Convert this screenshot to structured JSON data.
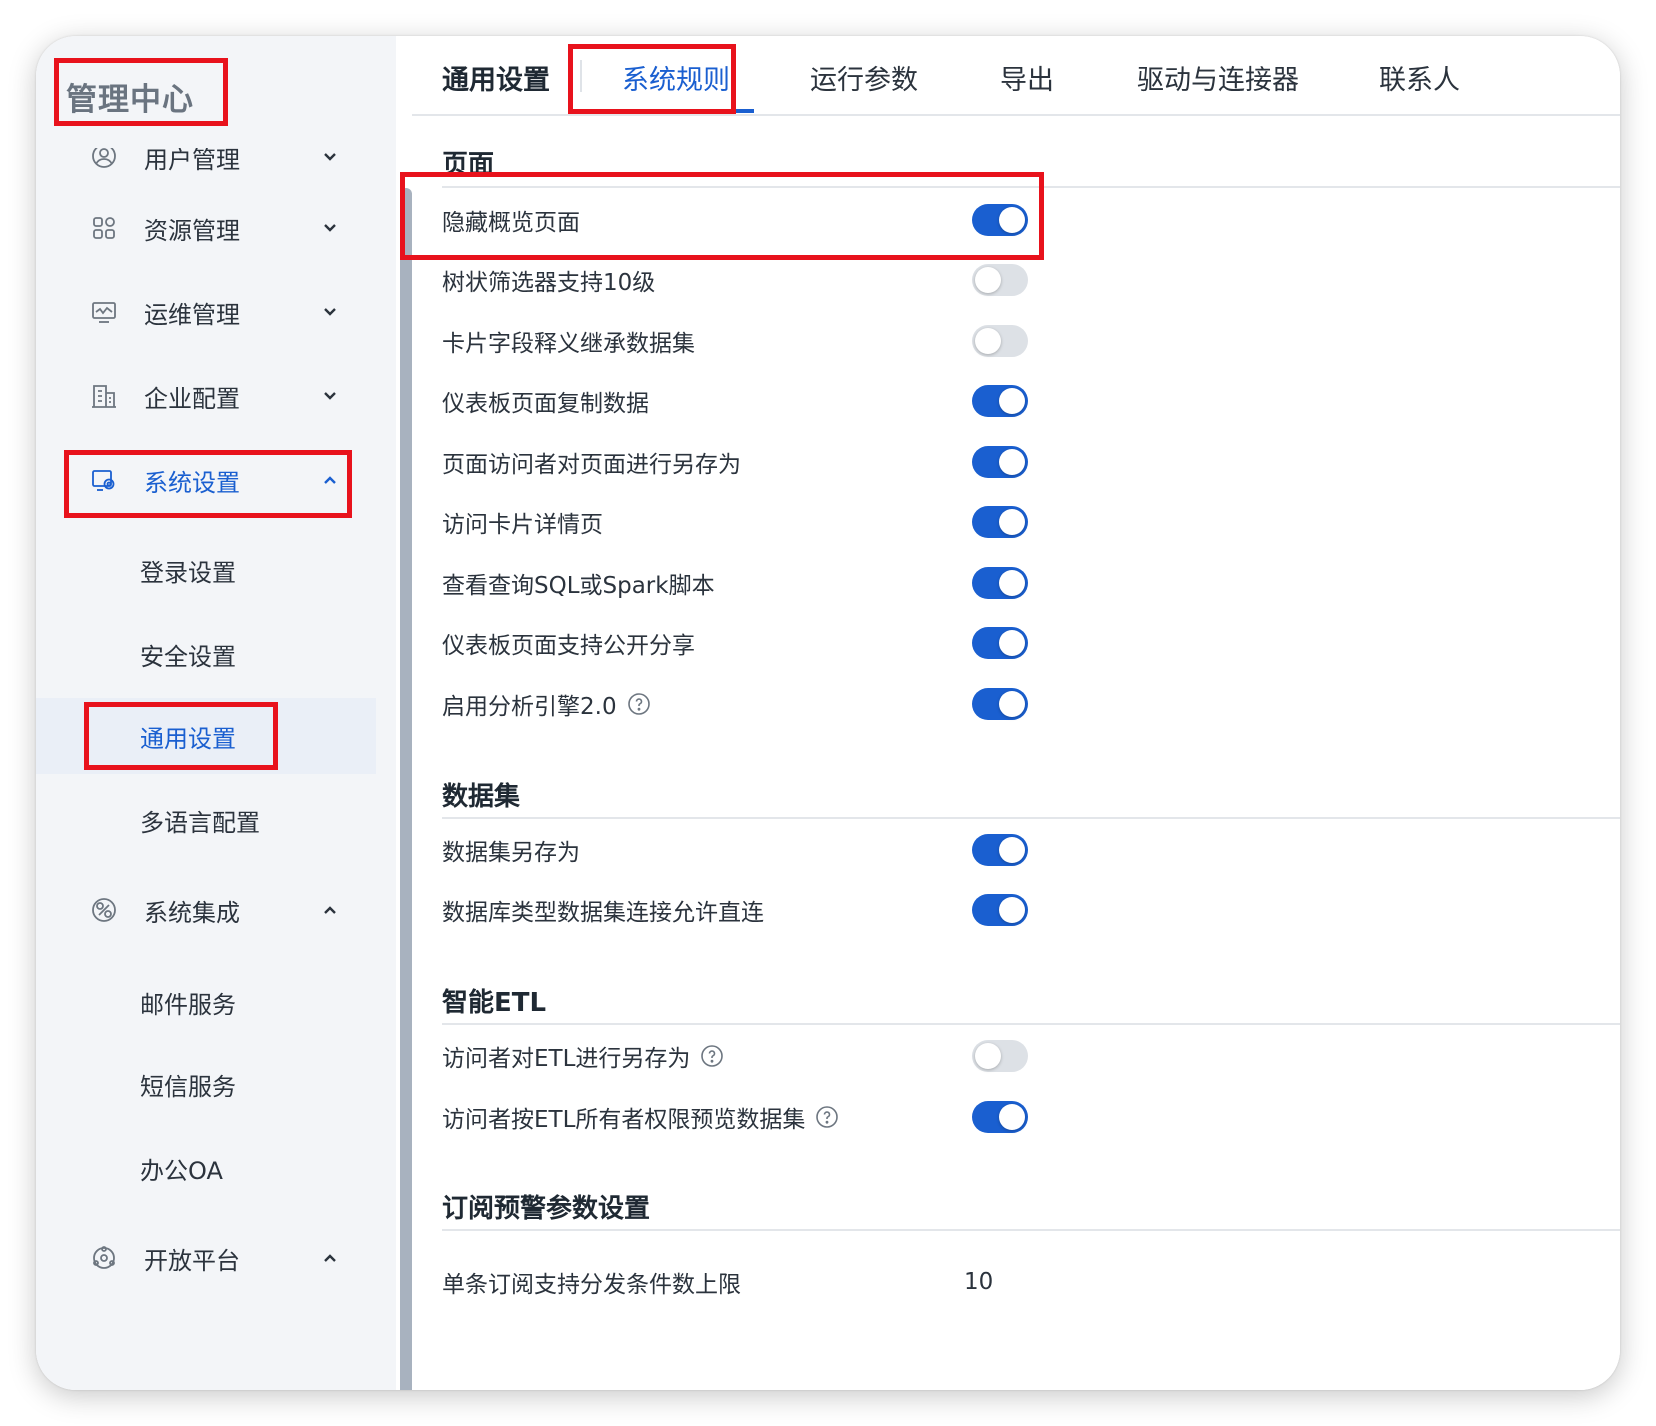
{
  "sidebar": {
    "title": "管理中心",
    "partial_item": {
      "label": "用户管理",
      "icon": "user-icon"
    },
    "items": [
      {
        "label": "资源管理",
        "icon": "grid-icon",
        "expanded": false
      },
      {
        "label": "运维管理",
        "icon": "monitor-icon",
        "expanded": false
      },
      {
        "label": "企业配置",
        "icon": "building-icon",
        "expanded": false
      },
      {
        "label": "系统设置",
        "icon": "settings-icon",
        "expanded": true,
        "active": true
      }
    ],
    "system_settings_children": [
      "登录设置",
      "安全设置",
      "通用设置",
      "多语言配置"
    ],
    "selected_child": "通用设置",
    "integration": {
      "label": "系统集成",
      "icon": "integration-icon",
      "expanded": true
    },
    "integration_children": [
      "邮件服务",
      "短信服务",
      "办公OA"
    ],
    "open_platform": {
      "label": "开放平台",
      "icon": "platform-icon",
      "expanded": true
    }
  },
  "tabs": [
    {
      "label": "通用设置"
    },
    {
      "label": "系统规则",
      "active": true
    },
    {
      "label": "运行参数"
    },
    {
      "label": "导出"
    },
    {
      "label": "驱动与连接器"
    },
    {
      "label": "联系人"
    }
  ],
  "sections": {
    "page": {
      "title": "页面",
      "rows": [
        {
          "label": "隐藏概览页面",
          "on": true
        },
        {
          "label": "树状筛选器支持10级",
          "on": false
        },
        {
          "label": "卡片字段释义继承数据集",
          "on": false
        },
        {
          "label": "仪表板页面复制数据",
          "on": true
        },
        {
          "label": "页面访问者对页面进行另存为",
          "on": true
        },
        {
          "label": "访问卡片详情页",
          "on": true
        },
        {
          "label": "查看查询SQL或Spark脚本",
          "on": true
        },
        {
          "label": "仪表板页面支持公开分享",
          "on": true
        },
        {
          "label": "启用分析引擎2.0",
          "on": true,
          "help": true
        }
      ]
    },
    "dataset": {
      "title": "数据集",
      "rows": [
        {
          "label": "数据集另存为",
          "on": true
        },
        {
          "label": "数据库类型数据集连接允许直连",
          "on": true
        }
      ]
    },
    "etl": {
      "title": "智能ETL",
      "rows": [
        {
          "label": "访问者对ETL进行另存为",
          "on": false,
          "help": true
        },
        {
          "label": "访问者按ETL所有者权限预览数据集",
          "on": true,
          "help": true
        }
      ]
    },
    "subscription": {
      "title": "订阅预警参数设置",
      "rows": [
        {
          "label": "单条订阅支持分发条件数上限",
          "value": "10"
        }
      ]
    }
  },
  "colors": {
    "accent": "#1a5fd0",
    "annotation": "#e8121c",
    "toggle_off": "#dde1e6"
  }
}
